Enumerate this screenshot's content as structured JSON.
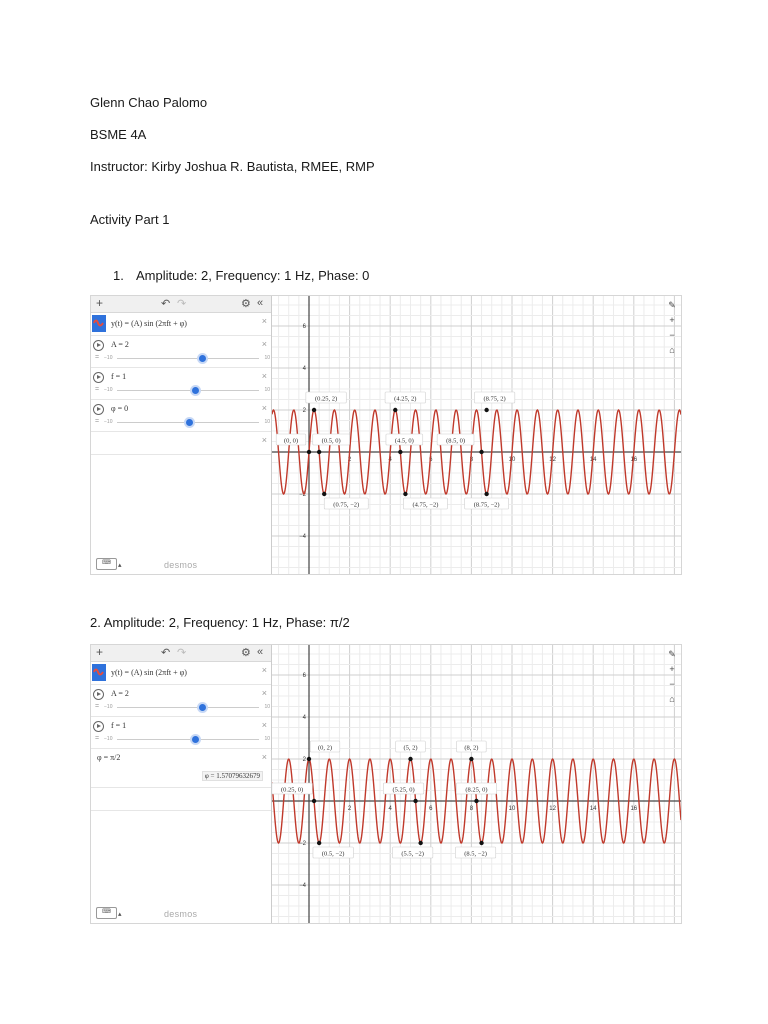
{
  "student": "Glenn Chao Palomo",
  "section": "BSME 4A",
  "instructor": "Instructor: Kirby Joshua R. Bautista, RMEE, RMP",
  "activity": "Activity Part 1",
  "item1": {
    "number": "1.",
    "text": "Amplitude: 2, Frequency: 1 Hz, Phase: 0"
  },
  "item2": {
    "text": "2. Amplitude: 2, Frequency: 1 Hz, Phase: π/2"
  },
  "desmos": {
    "expression": "y(t) = (A) sin (2πft + φ)",
    "brand": "desmos",
    "slider_min": "−10",
    "slider_max": "10",
    "keyboard_label": "⌨",
    "tools": {
      "wrench": "🔧",
      "zoom_in": "+",
      "zoom_out": "−",
      "home": "⌂"
    },
    "toolbar": {
      "add": "+",
      "undo": "↶",
      "redo": "↷",
      "gear": "⚙",
      "collapse": "«"
    }
  },
  "graph1": {
    "amplitude_label": "A = 2",
    "frequency_label": "f = 1",
    "phase_label": "φ = 0",
    "amplitude_value": 2,
    "frequency_value": 1,
    "phase_value": 0,
    "phase_slider_fraction": 0.5,
    "curve_color": "#c0392b",
    "x_ticks": [
      "2",
      "4",
      "6",
      "8",
      "10",
      "12",
      "14",
      "16"
    ],
    "y_ticks": [
      "6",
      "4",
      "2",
      "−2",
      "−4"
    ],
    "points": [
      {
        "label": "(0.25, 2)",
        "x": 0.25,
        "y": 2
      },
      {
        "label": "(4.25, 2)",
        "x": 4.25,
        "y": 2
      },
      {
        "label": "(8.75, 2)",
        "x": 8.75,
        "y": 2
      },
      {
        "label": "(0, 0)",
        "x": 0,
        "y": 0
      },
      {
        "label": "(0.5, 0)",
        "x": 0.5,
        "y": 0
      },
      {
        "label": "(4.5, 0)",
        "x": 4.5,
        "y": 0
      },
      {
        "label": "(8.5, 0)",
        "x": 8.5,
        "y": 0
      },
      {
        "label": "(0.75, −2)",
        "x": 0.75,
        "y": -2
      },
      {
        "label": "(4.75, −2)",
        "x": 4.75,
        "y": -2
      },
      {
        "label": "(8.75, −2)",
        "x": 8.75,
        "y": -2
      }
    ]
  },
  "graph2": {
    "amplitude_label": "A = 2",
    "frequency_label": "f = 1",
    "phase_label": "φ = π/2",
    "phase_numeric": "φ = 1.57079632679",
    "amplitude_value": 2,
    "frequency_value": 1,
    "phase_value": 1.5708,
    "curve_color": "#c0392b",
    "x_ticks": [
      "2",
      "4",
      "6",
      "8",
      "10",
      "12",
      "14",
      "16"
    ],
    "y_ticks": [
      "6",
      "4",
      "2",
      "−2",
      "−4"
    ],
    "points": [
      {
        "label": "(0, 2)",
        "x": 0,
        "y": 2
      },
      {
        "label": "(5, 2)",
        "x": 5,
        "y": 2
      },
      {
        "label": "(8, 2)",
        "x": 8,
        "y": 2
      },
      {
        "label": "(0.25, 0)",
        "x": 0.25,
        "y": 0
      },
      {
        "label": "(5.25, 0)",
        "x": 5.25,
        "y": 0
      },
      {
        "label": "(8.25, 0)",
        "x": 8.25,
        "y": 0
      },
      {
        "label": "(0.5, −2)",
        "x": 0.5,
        "y": -2
      },
      {
        "label": "(5.5, −2)",
        "x": 5.5,
        "y": -2
      },
      {
        "label": "(8.5, −2)",
        "x": 8.5,
        "y": -2
      }
    ]
  }
}
